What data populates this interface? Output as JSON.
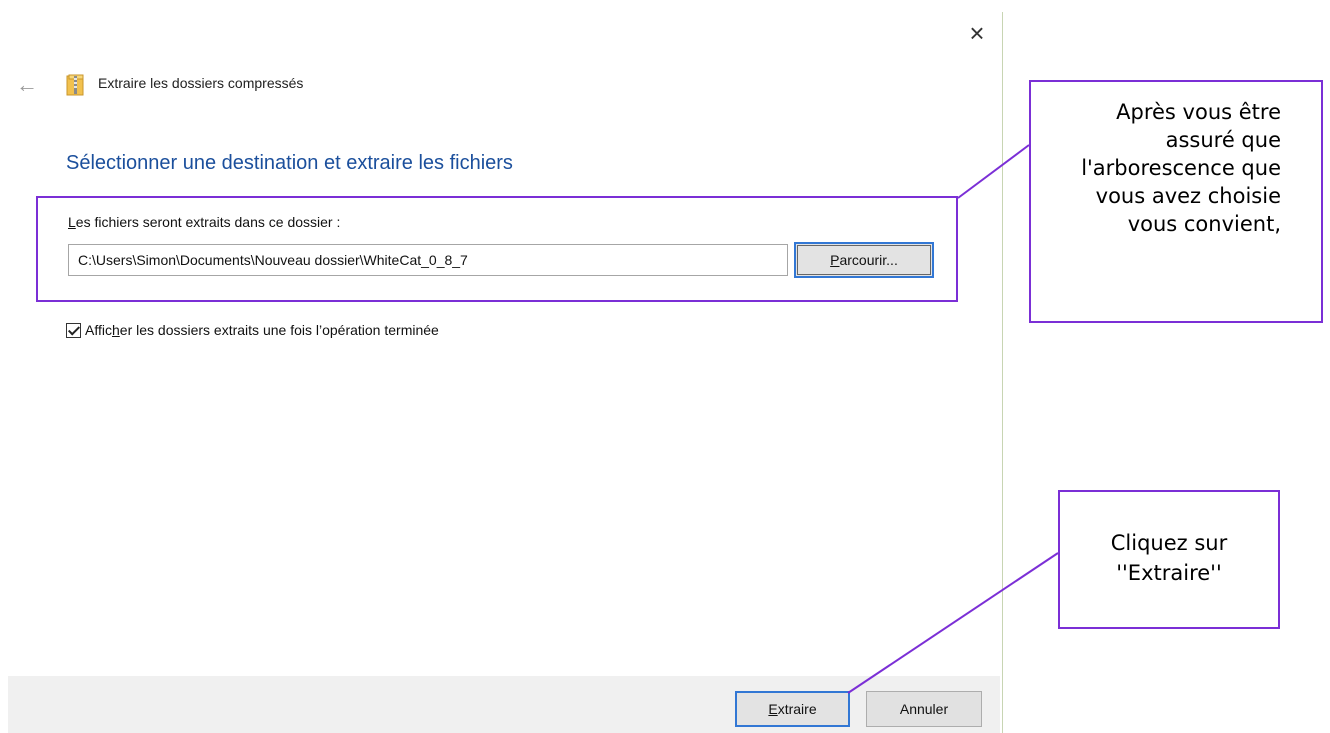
{
  "window": {
    "close_glyph": "×",
    "back_glyph": "←",
    "title": "Extraire les dossiers compressés",
    "close_icon": "close-icon",
    "back_icon": "back-arrow-icon",
    "app_icon": "zip-folder-icon"
  },
  "main": {
    "heading": "Sélectionner une destination et extraire les fichiers",
    "destination_label_first": "L",
    "destination_label_rest": "es fichiers seront extraits dans ce dossier :",
    "destination_path": "C:\\Users\\Simon\\Documents\\Nouveau dossier\\WhiteCat_0_8_7",
    "browse_button_first": "P",
    "browse_button_rest": "arcourir...",
    "show_folders_checked": true,
    "show_folders_label_pre": "Affic",
    "show_folders_label_key": "h",
    "show_folders_label_post": "er les dossiers extraits une fois l’opération terminée"
  },
  "footer": {
    "extract_first": "E",
    "extract_rest": "xtraire",
    "cancel": "Annuler"
  },
  "annotations": {
    "callout_top": "Après vous être assuré que l'arborescence que vous avez choisie vous convient,",
    "callout_bottom": "Cliquez sur ''Extraire''",
    "accent_color": "#7b2fd6"
  },
  "colors": {
    "heading": "#1b4f9c",
    "focus_border": "#3277d4",
    "footer_bg": "#f0f0f0"
  }
}
